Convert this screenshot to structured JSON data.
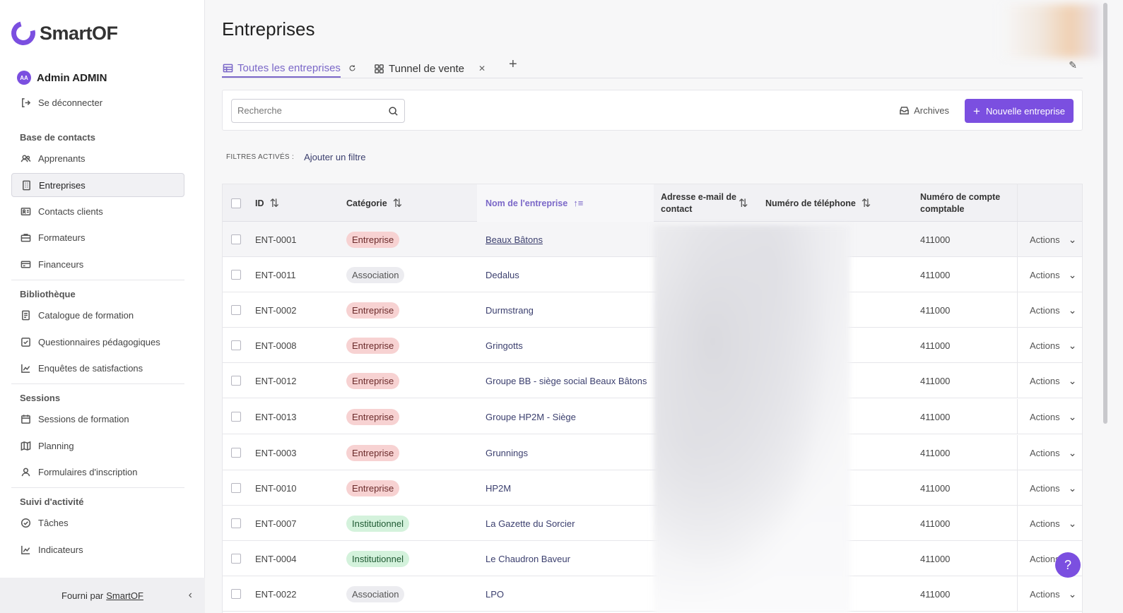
{
  "brand": {
    "name": "SmartOF"
  },
  "user": {
    "initials": "AA",
    "name": "Admin ADMIN",
    "logout": "Se déconnecter"
  },
  "sidebar": {
    "sections": [
      {
        "title": "Base de contacts",
        "items": [
          "Apprenants",
          "Entreprises",
          "Contacts clients",
          "Formateurs",
          "Financeurs"
        ]
      },
      {
        "title": "Bibliothèque",
        "items": [
          "Catalogue de formation",
          "Questionnaires pédagogiques",
          "Enquêtes de satisfactions"
        ]
      },
      {
        "title": "Sessions",
        "items": [
          "Sessions de formation",
          "Planning",
          "Formulaires d'inscription"
        ]
      },
      {
        "title": "Suivi d'activité",
        "items": [
          "Tâches",
          "Indicateurs"
        ]
      }
    ],
    "active_item": "Entreprises",
    "footer": {
      "prefix": "Fourni par",
      "link": "SmartOF"
    }
  },
  "page": {
    "title": "Entreprises"
  },
  "tabs": [
    {
      "label": "Toutes les entreprises",
      "active": true
    },
    {
      "label": "Tunnel de vente",
      "active": false
    }
  ],
  "toolbar": {
    "search_placeholder": "Recherche",
    "archives_label": "Archives",
    "new_button_label": "Nouvelle entreprise"
  },
  "filters": {
    "label": "FILTRES ACTIVÉS :",
    "add_label": "Ajouter un filtre"
  },
  "table": {
    "columns": {
      "id": "ID",
      "category": "Catégorie",
      "name": "Nom de l'entreprise",
      "email": "Adresse e-mail de contact",
      "phone": "Numéro de téléphone",
      "account": "Numéro de compte comptable"
    },
    "action_label": "Actions",
    "rows": [
      {
        "id": "ENT-0001",
        "category": "Entreprise",
        "name": "Beaux Bâtons",
        "account": "411000"
      },
      {
        "id": "ENT-0011",
        "category": "Association",
        "name": "Dedalus",
        "account": "411000"
      },
      {
        "id": "ENT-0002",
        "category": "Entreprise",
        "name": "Durmstrang",
        "account": "411000"
      },
      {
        "id": "ENT-0008",
        "category": "Entreprise",
        "name": "Gringotts",
        "account": "411000"
      },
      {
        "id": "ENT-0012",
        "category": "Entreprise",
        "name": "Groupe BB - siège social Beaux Bâtons",
        "account": "411000"
      },
      {
        "id": "ENT-0013",
        "category": "Entreprise",
        "name": "Groupe HP2M - Siège",
        "account": "411000"
      },
      {
        "id": "ENT-0003",
        "category": "Entreprise",
        "name": "Grunnings",
        "account": "411000"
      },
      {
        "id": "ENT-0010",
        "category": "Entreprise",
        "name": "HP2M",
        "account": "411000"
      },
      {
        "id": "ENT-0007",
        "category": "Institutionnel",
        "name": "La Gazette du Sorcier",
        "account": "411000"
      },
      {
        "id": "ENT-0004",
        "category": "Institutionnel",
        "name": "Le Chaudron Baveur",
        "account": "411000"
      },
      {
        "id": "ENT-0022",
        "category": "Association",
        "name": "LPO",
        "account": "411000"
      }
    ]
  },
  "help": {
    "label": "?"
  },
  "colors": {
    "accent": "#7b4fe0",
    "tab_active": "#7b68c8",
    "badge_entreprise": "#f7d2d2",
    "badge_association": "#ececf0",
    "badge_institutionnel": "#d4f2dc"
  }
}
